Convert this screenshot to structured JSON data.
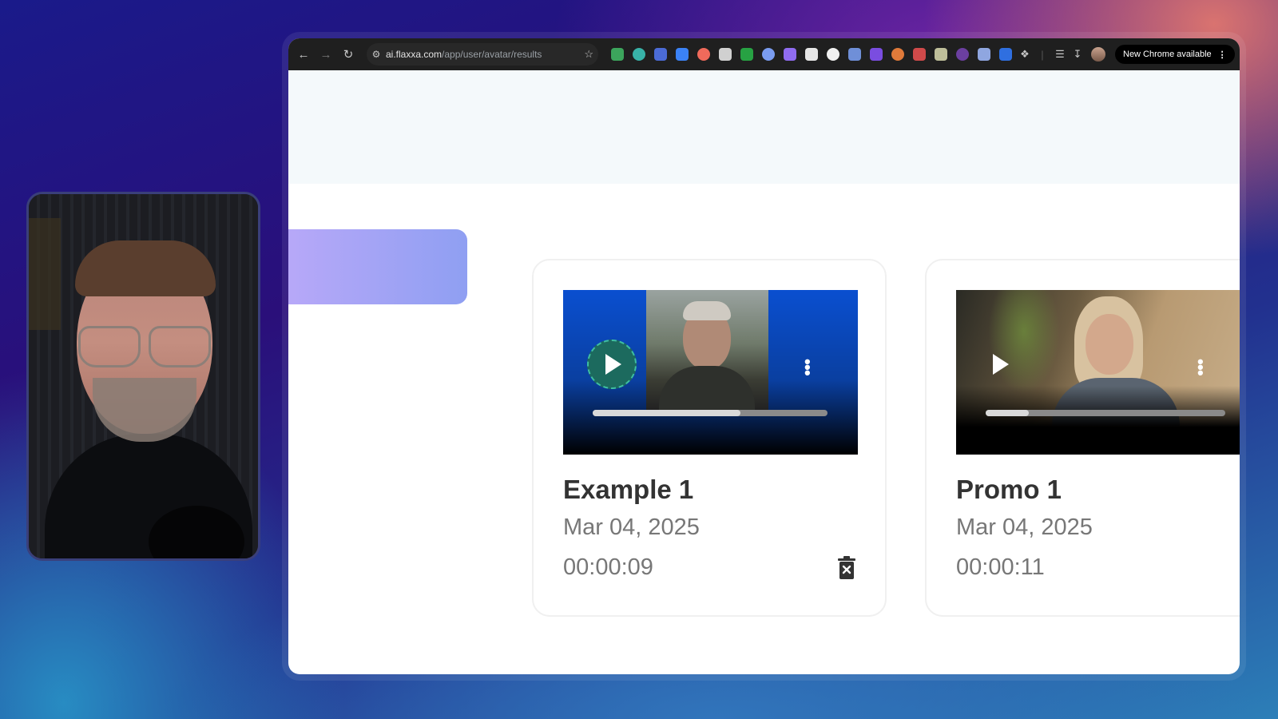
{
  "browser": {
    "url_host": "ai.flaxxa.com",
    "url_path": "/app/user/avatar/results",
    "update_label": "New Chrome available"
  },
  "icons": {
    "back": "arrow-left-icon",
    "forward": "arrow-right-icon",
    "reload": "reload-icon",
    "site_settings": "tune-icon",
    "bookmark": "star-icon",
    "menu": "kebab-icon",
    "delete": "trash-icon",
    "play": "play-icon"
  },
  "extension_colors": [
    "#3ca55c",
    "#38b2a8",
    "#4b6bd6",
    "#3b82f6",
    "#f06a5b",
    "#d0d0d0",
    "#27a243",
    "#7a9cf0",
    "#8f6cf0",
    "#e6e6e6",
    "#f1f1f1",
    "#6f8fd8",
    "#7a4de0",
    "#e07a3a",
    "#d04a4a",
    "#bfbf9a",
    "#6b3fa0",
    "#8fa6e0",
    "#2f6fe0"
  ],
  "cards": [
    {
      "title": "Example 1",
      "date": "Mar 04, 2025",
      "duration": "00:00:09",
      "progress": 0.63,
      "has_delete": true
    },
    {
      "title": "Promo 1",
      "date": "Mar 04, 2025",
      "duration": "00:00:11",
      "progress": 0.18,
      "has_delete": false
    }
  ]
}
